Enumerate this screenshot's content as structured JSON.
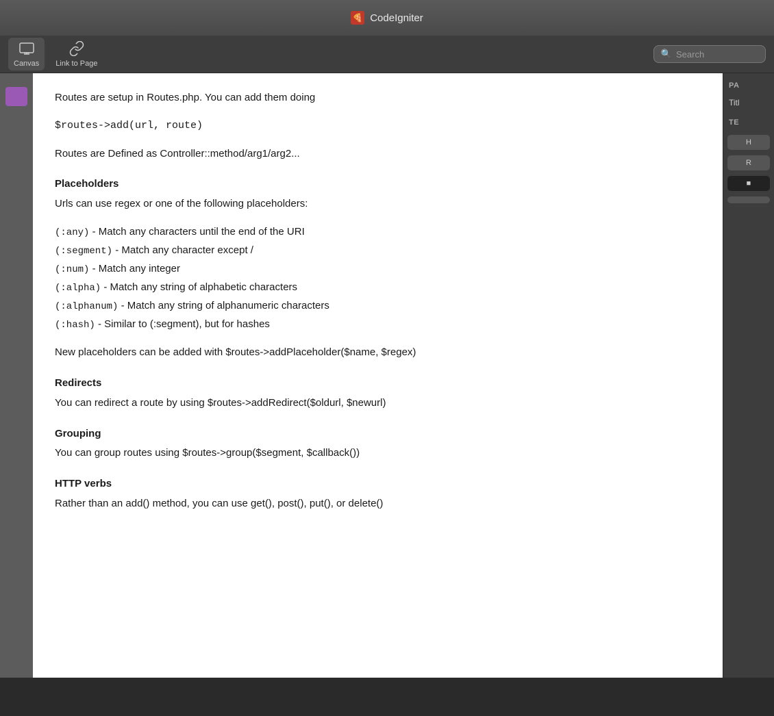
{
  "titleBar": {
    "title": "CodeIgniter",
    "iconLabel": "CI"
  },
  "toolbar": {
    "canvasBtn": {
      "label": "Canvas",
      "iconUnicode": "🖥"
    },
    "linkBtn": {
      "label": "Link to Page",
      "iconUnicode": "🔗"
    },
    "searchPlaceholder": "Search"
  },
  "content": {
    "intro1": "Routes are setup in Routes.php. You can add them doing",
    "codeAdd": "$routes->add(url, route)",
    "intro2": "Routes are Defined as Controller::method/arg1/arg2...",
    "placeholders": {
      "title": "Placeholders",
      "intro": "Urls can use regex or one of the following placeholders:",
      "items": [
        {
          "code": "(:any)",
          "desc": " - Match any characters until the end of the URI"
        },
        {
          "code": "(:segment)",
          "desc": " - Match any character except /"
        },
        {
          "code": "(:num)",
          "desc": " - Match any integer"
        },
        {
          "code": "(:alpha)",
          "desc": " - Match any string of alphabetic characters"
        },
        {
          "code": "(:alphanum)",
          "desc": " - Match any string of alphanumeric characters"
        },
        {
          "code": "(:hash)",
          "desc": " - Similar to (:segment), but for hashes"
        }
      ],
      "newPlaceholders": "New placeholders can be added with $routes->addPlaceholder($name, $regex)"
    },
    "redirects": {
      "title": "Redirects",
      "body": "You can redirect a route by using $routes->addRedirect($oldurl, $newurl)"
    },
    "grouping": {
      "title": "Grouping",
      "body": "You can group routes using $routes->group($segment, $callback())"
    },
    "httpVerbs": {
      "title": "HTTP verbs",
      "body": "Rather than an add() method, you can use get(), post(), put(), or delete()"
    }
  },
  "rightSidebar": {
    "pageHeader": "PA",
    "titleLabel": "Titl",
    "textHeader": "TE",
    "btn1": "H",
    "btn2": "R",
    "btn3Dark": "■",
    "btn4": ""
  }
}
